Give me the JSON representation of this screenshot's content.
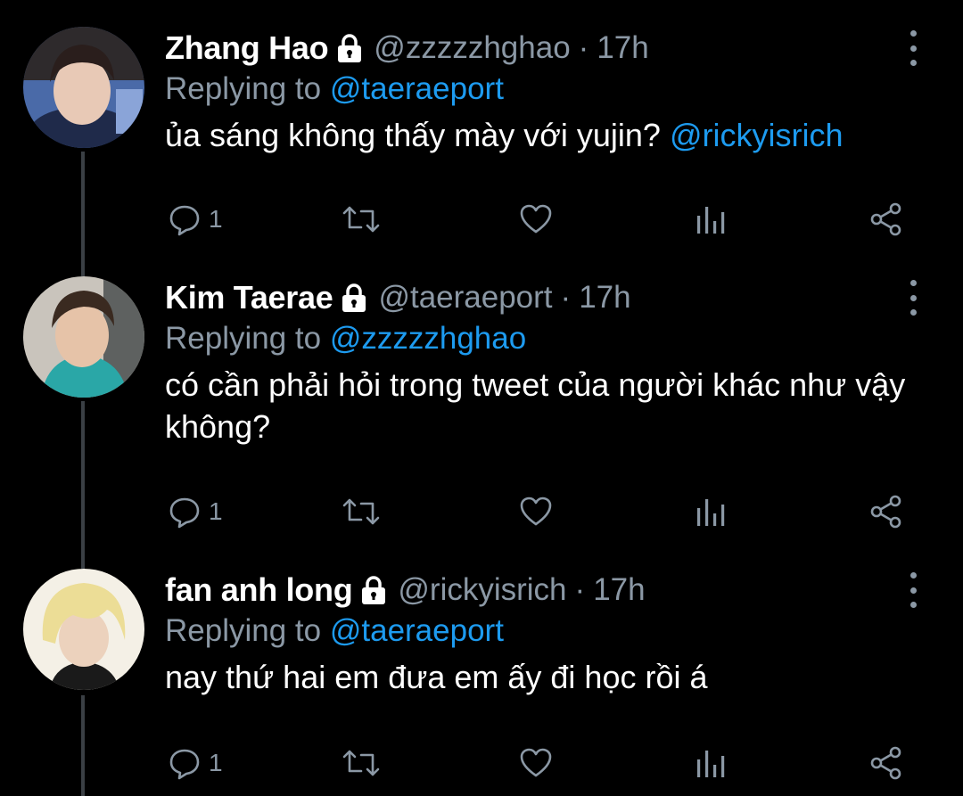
{
  "accent_color": "#1d9bf0",
  "muted_color": "#8b98a5",
  "tweets": [
    {
      "name": "Zhang Hao",
      "handle": "@zzzzzhghao",
      "separator": "·",
      "time": "17h",
      "replying_prefix": "Replying to",
      "replying_to": "@taeraeport",
      "text": "ủa sáng không thấy mày với yujin?",
      "text_mention": "@rickyisrich",
      "reply_count": "1",
      "icons": [
        "lock-icon",
        "reply-icon",
        "retweet-icon",
        "like-icon",
        "analytics-icon",
        "share-icon",
        "more-icon"
      ]
    },
    {
      "name": "Kim Taerae",
      "handle": "@taeraeport",
      "separator": "·",
      "time": "17h",
      "replying_prefix": "Replying to",
      "replying_to": "@zzzzzhghao",
      "text": "có cần phải hỏi trong tweet của người khác như vậy không?",
      "text_mention": "",
      "reply_count": "1",
      "icons": [
        "lock-icon",
        "reply-icon",
        "retweet-icon",
        "like-icon",
        "analytics-icon",
        "share-icon",
        "more-icon"
      ]
    },
    {
      "name": "fan anh long",
      "handle": "@rickyisrich",
      "separator": "·",
      "time": "17h",
      "replying_prefix": "Replying to",
      "replying_to": "@taeraeport",
      "text": "nay thứ hai em đưa em ấy đi học rồi á",
      "text_mention": "",
      "reply_count": "1",
      "icons": [
        "lock-icon",
        "reply-icon",
        "retweet-icon",
        "like-icon",
        "analytics-icon",
        "share-icon",
        "more-icon"
      ]
    }
  ]
}
